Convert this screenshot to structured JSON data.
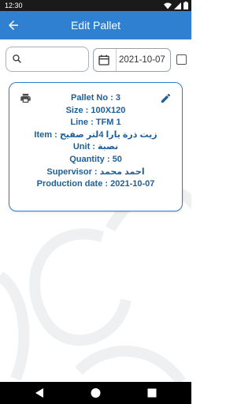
{
  "status_bar": {
    "time": "12:30"
  },
  "app_bar": {
    "title": "Edit Pallet"
  },
  "filters": {
    "search_placeholder": "",
    "date": "2021-10-07"
  },
  "pallet_card": {
    "pallet_no": "Pallet No : 3",
    "size": "Size : 100X120",
    "line": "Line : TFM 1",
    "item": "Item : زيت ذرة يارا 4لتر صفيح",
    "unit": "Unit : نصبة",
    "quantity": "Quantity : 50",
    "supervisor": "Supervisor : احمد محمد",
    "production_date": "Production date : 2021-10-07"
  },
  "colors": {
    "primary": "#2f80d1",
    "card_text": "#1f5f99",
    "status_bar": "#1a1a1a",
    "nav_bar": "#000000"
  },
  "icons": [
    "wifi-icon",
    "signal-icon",
    "battery-icon",
    "back-arrow-icon",
    "search-icon",
    "calendar-icon",
    "print-icon",
    "edit-icon",
    "nav-back-icon",
    "nav-home-icon",
    "nav-recents-icon"
  ]
}
